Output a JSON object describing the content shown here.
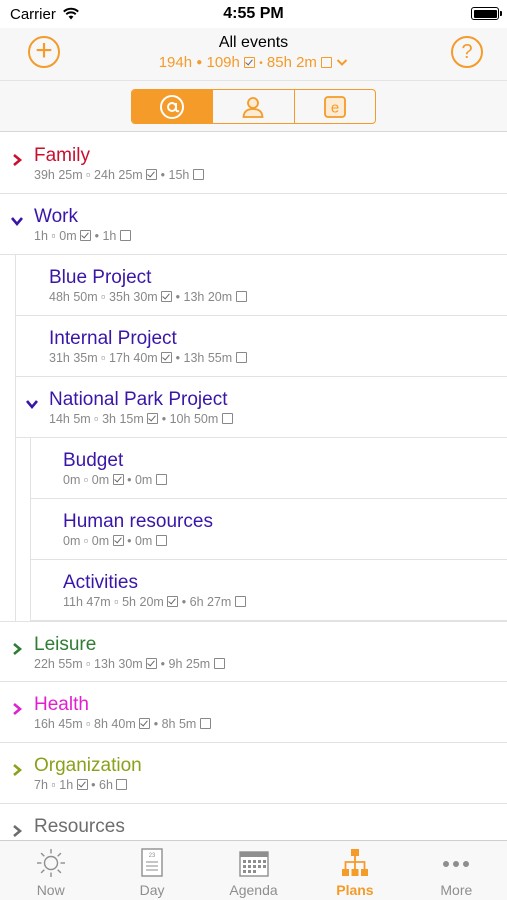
{
  "status_bar": {
    "carrier": "Carrier",
    "time": "4:55 PM"
  },
  "header": {
    "title": "All events",
    "summary_a": "194h",
    "summary_b": "109h",
    "summary_c": "85h 2m",
    "add_icon": "plus-circle-icon",
    "help_icon": "question-circle-icon"
  },
  "segments": [
    {
      "icon": "at-icon",
      "selected": true
    },
    {
      "icon": "person-icon",
      "selected": false
    },
    {
      "icon": "e-icon",
      "selected": false
    }
  ],
  "colors": {
    "accent": "#f49b2a",
    "family": "#c8102e",
    "work": "#3a16a8",
    "leisure": "#2e7d32",
    "health": "#e020d0",
    "organization": "#8aa11b",
    "resources": "#6d6d6d"
  },
  "plans": [
    {
      "name": "Family",
      "total": "39h 25m",
      "done": "24h 25m",
      "open": "15h"
    },
    {
      "name": "Work",
      "total": "1h",
      "done": "0m",
      "open": "1h"
    },
    {
      "name": "Blue Project",
      "total": "48h 50m",
      "done": "35h 30m",
      "open": "13h 20m"
    },
    {
      "name": "Internal Project",
      "total": "31h 35m",
      "done": "17h 40m",
      "open": "13h 55m"
    },
    {
      "name": "National Park Project",
      "total": "14h 5m",
      "done": "3h 15m",
      "open": "10h 50m"
    },
    {
      "name": "Budget",
      "total": "0m",
      "done": "0m",
      "open": "0m"
    },
    {
      "name": "Human resources",
      "total": "0m",
      "done": "0m",
      "open": "0m"
    },
    {
      "name": "Activities",
      "total": "11h 47m",
      "done": "5h 20m",
      "open": "6h 27m"
    },
    {
      "name": "Leisure",
      "total": "22h 55m",
      "done": "13h 30m",
      "open": "9h 25m"
    },
    {
      "name": "Health",
      "total": "16h 45m",
      "done": "8h 40m",
      "open": "8h 5m"
    },
    {
      "name": "Organization",
      "total": "7h",
      "done": "1h",
      "open": "6h"
    },
    {
      "name": "Resources",
      "total": "",
      "done": "",
      "open": ""
    }
  ],
  "tabs": [
    {
      "label": "Now",
      "icon": "sun-icon",
      "active": false
    },
    {
      "label": "Day",
      "icon": "day-page-icon",
      "day_number": "23",
      "active": false
    },
    {
      "label": "Agenda",
      "icon": "calendar-icon",
      "active": false
    },
    {
      "label": "Plans",
      "icon": "hierarchy-icon",
      "active": true
    },
    {
      "label": "More",
      "icon": "ellipsis-icon",
      "active": false
    }
  ]
}
